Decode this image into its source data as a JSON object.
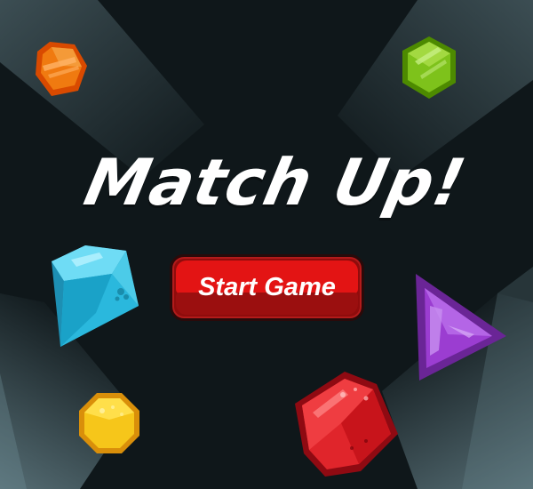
{
  "game": {
    "title": "Match Up!",
    "start_button_label": "Start Game"
  },
  "gems": [
    {
      "shape": "hexagon",
      "color": "orange"
    },
    {
      "shape": "hexagon",
      "color": "green"
    },
    {
      "shape": "diamond",
      "color": "cyan"
    },
    {
      "shape": "triangle",
      "color": "purple"
    },
    {
      "shape": "octagon",
      "color": "yellow"
    },
    {
      "shape": "octagon",
      "color": "red"
    }
  ],
  "colors": {
    "background": "#0f171a",
    "spotlight": "#8fb3bd",
    "button_face": "#e31414",
    "button_shadow": "#9b0f0f",
    "title_text": "#ffffff"
  }
}
